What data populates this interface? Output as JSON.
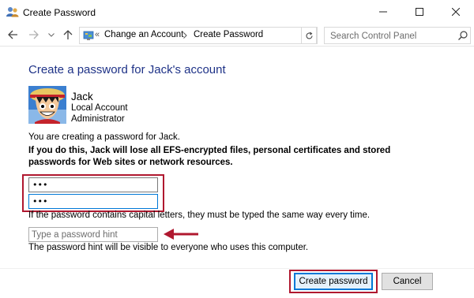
{
  "window": {
    "title": "Create Password",
    "controls": {
      "minimize": "minimize-icon",
      "maximize": "maximize-icon",
      "close": "close-icon"
    }
  },
  "navigation": {
    "breadcrumb_prefix": "«",
    "breadcrumbs": [
      "Change an Account",
      "Create Password"
    ],
    "search_placeholder": "Search Control Panel"
  },
  "page": {
    "heading": "Create a password for Jack's account",
    "user": {
      "name": "Jack",
      "account_type": "Local Account",
      "role": "Administrator"
    },
    "info": "You are creating a password for Jack.",
    "warning": "If you do this, Jack will lose all EFS-encrypted files, personal certificates and stored passwords for Web sites or network resources.",
    "new_password_value": "•••",
    "confirm_password_value": "•••",
    "caps_note": "If the password contains capital letters, they must be typed the same way every time.",
    "hint_placeholder": "Type a password hint",
    "hint_note": "The password hint will be visible to everyone who uses this computer."
  },
  "buttons": {
    "create": "Create password",
    "cancel": "Cancel"
  },
  "colors": {
    "heading": "#1e3287",
    "highlight": "#b0182f",
    "focus": "#0078d7"
  }
}
